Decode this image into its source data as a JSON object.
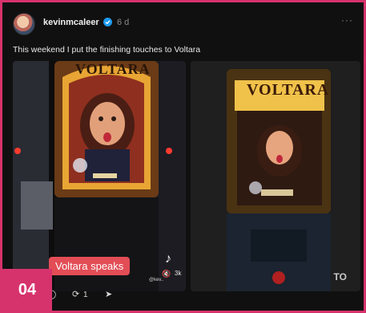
{
  "post": {
    "username": "kevinmcaleer",
    "time": "6 d",
    "more": "···",
    "caption": "This weekend I put the finishing touches to Voltara"
  },
  "media": {
    "left_overlay_text": "Voltara speaks",
    "left_sign_text": "VOLTARA",
    "right_sign_text": "VOLTARA",
    "tiktok_handle": "@kev..",
    "overlay_count": "3k",
    "watermark": "TO"
  },
  "actions": {
    "repost_count": "1"
  },
  "badge": {
    "page_number": "04"
  },
  "colors": {
    "accent": "#d6336c",
    "overlay_red": "#e24d56",
    "background": "#101010"
  },
  "icons": [
    "verified-icon",
    "more-icon",
    "tiktok-icon",
    "mute-icon",
    "comment-icon",
    "repost-icon",
    "share-icon"
  ]
}
